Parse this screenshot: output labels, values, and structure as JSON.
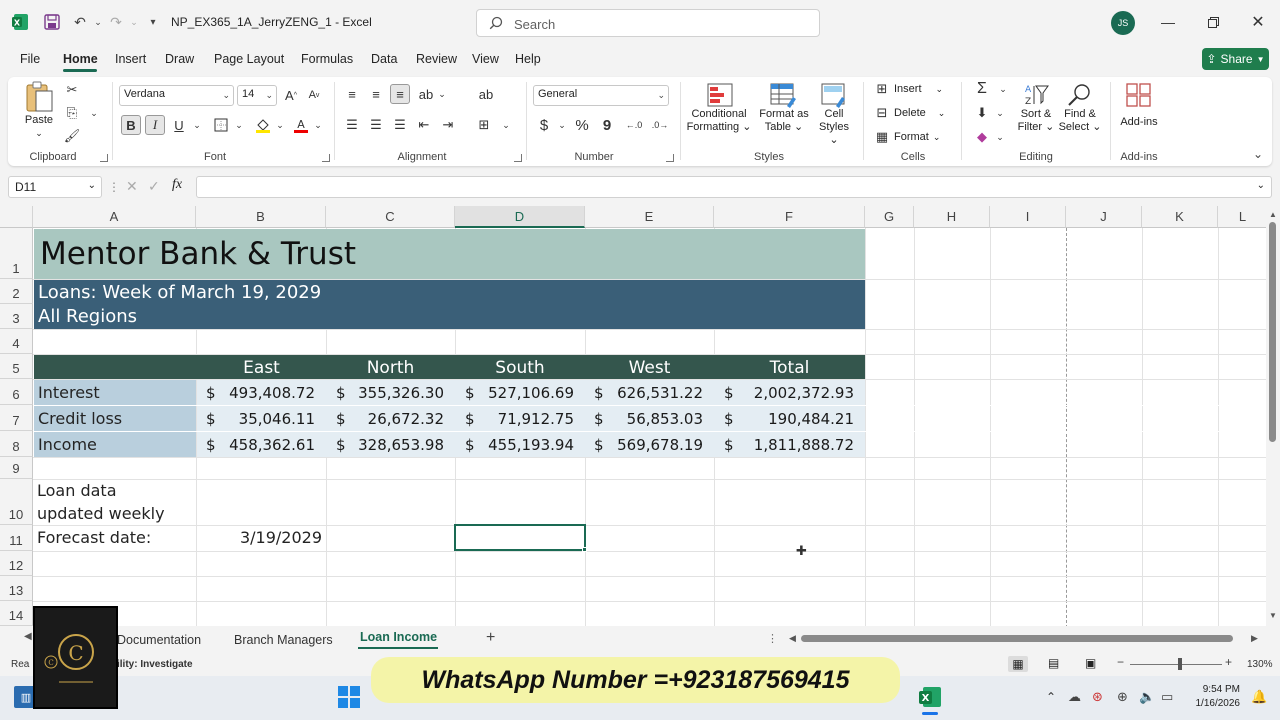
{
  "window": {
    "title": "NP_EX365_1A_JerryZENG_1  -  Excel",
    "user_initials": "JS"
  },
  "search": {
    "placeholder": "Search"
  },
  "menu": {
    "tabs": [
      "File",
      "Home",
      "Insert",
      "Draw",
      "Page Layout",
      "Formulas",
      "Data",
      "Review",
      "View",
      "Help"
    ],
    "share_label": "Share"
  },
  "ribbon": {
    "clipboard": {
      "paste": "Paste",
      "group": "Clipboard"
    },
    "font": {
      "family": "Verdana",
      "size": "14",
      "bold": "B",
      "italic": "I",
      "underline": "U",
      "group": "Font"
    },
    "alignment": {
      "group": "Alignment"
    },
    "number": {
      "format": "General",
      "currency": "$",
      "percent": "%",
      "comma": "9",
      "group": "Number"
    },
    "styles": {
      "conditional_1": "Conditional",
      "conditional_2": "Formatting",
      "format_table_1": "Format as",
      "format_table_2": "Table",
      "cell_styles_1": "Cell",
      "cell_styles_2": "Styles",
      "group": "Styles"
    },
    "cells": {
      "insert": "Insert",
      "delete": "Delete",
      "format": "Format",
      "group": "Cells"
    },
    "editing": {
      "sum": "Σ",
      "sort_1": "Sort &",
      "sort_2": "Filter",
      "find_1": "Find &",
      "find_2": "Select",
      "group": "Editing"
    },
    "addins": {
      "label": "Add-ins",
      "group": "Add-ins"
    }
  },
  "formula_bar": {
    "name_box": "D11",
    "fx": "fx",
    "content": ""
  },
  "grid": {
    "columns": [
      "A",
      "B",
      "C",
      "D",
      "E",
      "F",
      "G",
      "H",
      "I",
      "J",
      "K",
      "L"
    ],
    "rows": [
      "1",
      "2",
      "3",
      "4",
      "5",
      "6",
      "7",
      "8",
      "9",
      "10",
      "11",
      "12",
      "13",
      "14"
    ],
    "selected_column": "D",
    "selected_cell": "D11"
  },
  "sheet": {
    "title": "Mentor Bank & Trust",
    "subtitle_1": "Loans: Week of March 19, 2029",
    "subtitle_2": "All Regions",
    "headers": [
      "East",
      "North",
      "South",
      "West",
      "Total"
    ],
    "rows": [
      {
        "label": "Interest",
        "values": [
          "493,408.72",
          "355,326.30",
          "527,106.69",
          "626,531.22",
          "2,002,372.93"
        ]
      },
      {
        "label": "Credit loss",
        "values": [
          "35,046.11",
          "26,672.32",
          "71,912.75",
          "56,853.03",
          "190,484.21"
        ]
      },
      {
        "label": "Income",
        "values": [
          "458,362.61",
          "328,653.98",
          "455,193.94",
          "569,678.19",
          "1,811,888.72"
        ]
      }
    ],
    "currency_symbol": "$",
    "note_1": "Loan data",
    "note_2": "updated weekly",
    "forecast_label": "Forecast date:",
    "forecast_value": "3/19/2029"
  },
  "sheet_tabs": [
    "Documentation",
    "Branch Managers",
    "Loan Income"
  ],
  "status": {
    "ready": "Rea",
    "accessibility": "ility: Investigate",
    "zoom": "130%"
  },
  "overlay": {
    "whatsapp": "WhatsApp Number =+923187569415"
  },
  "taskbar": {
    "time": "9:54 PM",
    "date": "1/16/2026"
  },
  "colors": {
    "excel_green": "#1a6a53",
    "title_band": "#a9c7c0",
    "subtitle_band": "#3a5f78",
    "header_band": "#34564d",
    "label_band": "#b9cfdd",
    "value_band": "#e4edf3"
  }
}
